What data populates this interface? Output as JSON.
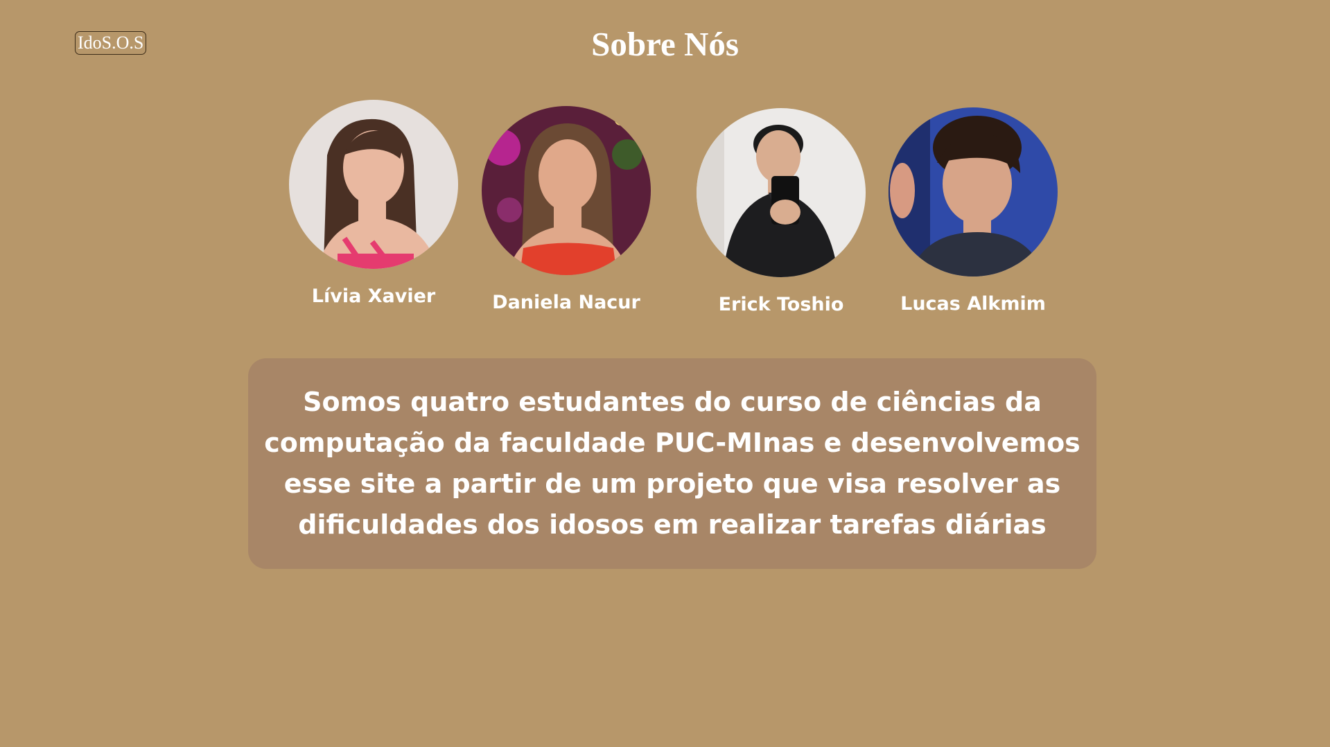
{
  "header": {
    "logo_label": "IdoS.O.S",
    "title": "Sobre Nós"
  },
  "team": [
    {
      "name": "Lívia Xavier",
      "photo": "lívia-photo",
      "colors": {
        "bg": "#e6e0dd",
        "hair": "#4a3024",
        "skin": "#e9b8a0",
        "outfit": "#e53b6f"
      }
    },
    {
      "name": "Daniela Nacur",
      "photo": "daniela-photo",
      "colors": {
        "bg": "#5a1f3a",
        "hair": "#6b4a34",
        "skin": "#e0a88a",
        "outfit": "#e2402c"
      }
    },
    {
      "name": "Erick Toshio",
      "photo": "erick-photo",
      "colors": {
        "bg": "#eceae8",
        "hair": "#1a1a1a",
        "skin": "#d9ad90",
        "outfit": "#1d1d1f"
      }
    },
    {
      "name": "Lucas Alkmim",
      "photo": "lucas-photo",
      "colors": {
        "bg": "#2f4aa8",
        "hair": "#2a1a12",
        "skin": "#d7a488",
        "outfit": "#2c3140"
      }
    }
  ],
  "about": {
    "text": "Somos quatro estudantes do curso de ciências da computação da faculdade PUC-MInas e desenvolvemos esse site a partir de um projeto que visa resolver as dificuldades dos idosos em realizar tarefas diárias"
  },
  "colors": {
    "background": "#b7976a",
    "card": "#a88667",
    "text": "#ffffff"
  }
}
